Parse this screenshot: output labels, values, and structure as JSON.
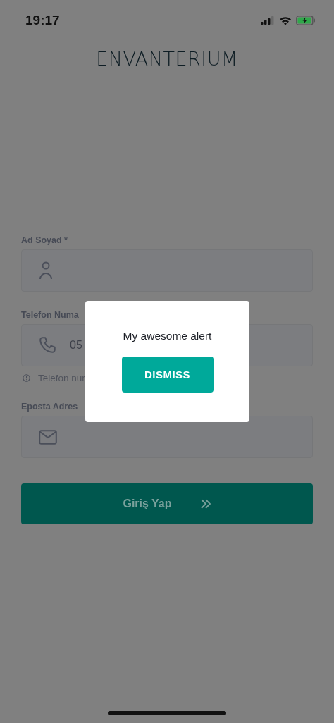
{
  "status_bar": {
    "time": "19:17"
  },
  "logo": "ENVANTERIUM",
  "form": {
    "fields": [
      {
        "kind": "name",
        "label": "Ad Soyad *"
      },
      {
        "kind": "phone",
        "label": "Telefon Numa",
        "value": "05",
        "hint": "Telefon nur"
      },
      {
        "kind": "email",
        "label": "Eposta Adres"
      }
    ],
    "submit": "Giriş Yap"
  },
  "alert": {
    "message": "My awesome alert",
    "button": "DISMISS"
  }
}
